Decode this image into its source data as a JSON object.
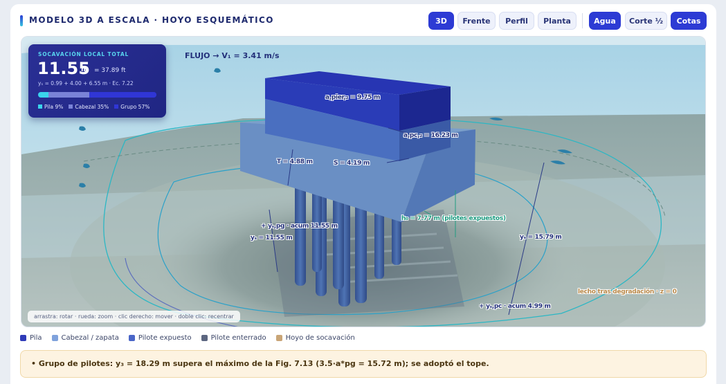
{
  "header": {
    "title": "MODELO 3D A ESCALA · HOYO ESQUEMÁTICO",
    "view_buttons": [
      "3D",
      "Frente",
      "Perfil",
      "Planta"
    ],
    "toggle_buttons": [
      "Agua",
      "Corte ½",
      "Cotas"
    ],
    "active_buttons": [
      "3D",
      "Agua",
      "Cotas"
    ]
  },
  "stat": {
    "label": "SOCAVACIÓN LOCAL TOTAL",
    "value": "11.55",
    "unit": "m",
    "feet": "= 37.89 ft",
    "equation": "yₛ = 0.99 + 4.00 + 6.55 m · Ec. 7.22",
    "shares": [
      {
        "name": "Pila",
        "percent": 9,
        "label": "Pila 9%",
        "color": "#3ad4ec"
      },
      {
        "name": "Cabezal",
        "percent": 35,
        "label": "Cabezal 35%",
        "color": "#7a83d8"
      },
      {
        "name": "Grupo",
        "percent": 57,
        "label": "Grupo 57%",
        "color": "#3036d6"
      }
    ]
  },
  "viewport": {
    "flow": "FLUJO → V₁ = 3.41 m/s",
    "dims": {
      "pier_width": "a,pier,₂ = 9.75 m",
      "pc_width": "a,pc,₂ = 16.23 m",
      "thickness": "T = 4.88 m",
      "spacing": "S = 4.19 m",
      "exposed_height": "h₀ = 7.77 m (pilotes expuestos)",
      "pg_accum": "+ yₛ,pg · acum 11.55 m",
      "ys_total": "yₛ = 11.55 m",
      "ys_right": "yₛ = 15.79 m",
      "pc_accum": "+ yₛ,pc · acum 4.99 m",
      "bed": "lecho tras degradación · z = 0"
    },
    "hint": "arrastra: rotar · rueda: zoom · clic derecho: mover · doble clic: recentrar"
  },
  "legend": [
    {
      "label": "Pila",
      "color": "#2f3bb8"
    },
    {
      "label": "Cabezal / zapata",
      "color": "#7fa2dc"
    },
    {
      "label": "Pilote expuesto",
      "color": "#4a66c8"
    },
    {
      "label": "Pilote enterrado",
      "color": "#5c6680"
    },
    {
      "label": "Hoyo de socavación",
      "color": "#c9a577"
    }
  ],
  "note": "• Grupo de pilotes: y₃ = 18.29 m supera el máximo de la Fig. 7.13 (3.5·a*pg = 15.72 m); se adoptó el tope."
}
